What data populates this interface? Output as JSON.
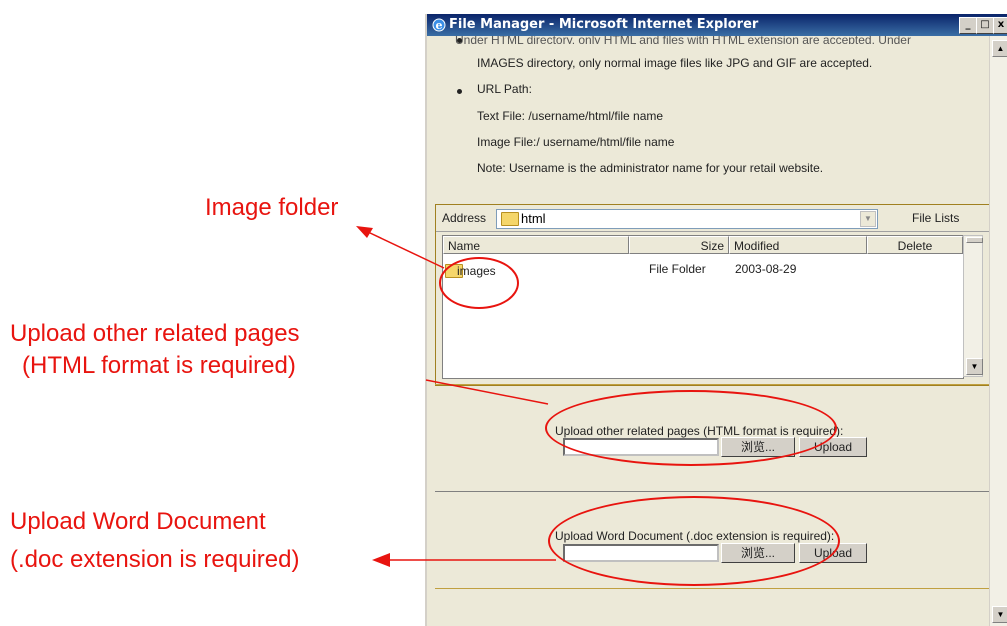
{
  "annotations": {
    "image_folder": "Image folder",
    "upload_pages_line1": "Upload other related pages",
    "upload_pages_line2": "(HTML format is required)",
    "upload_word_line1": "Upload Word Document",
    "upload_word_line2": "(.doc extension is required)"
  },
  "window": {
    "title": "File Manager - Microsoft Internet Explorer",
    "minimize": "_",
    "maximize": "□",
    "close": "x"
  },
  "info": {
    "cut_line": "Under HTML directory, only HTML and files with HTML extension are accepted. Under",
    "images_line": "IMAGES directory, only normal image files like JPG and GIF are accepted.",
    "url_path_label": "URL Path:",
    "text_file": "Text File: /username/html/file name",
    "image_file": "Image File:/ username/html/file name",
    "note": "Note: Username is the administrator name for your retail website."
  },
  "file_panel": {
    "address_label": "Address",
    "address_value": "html",
    "file_lists": "File Lists",
    "columns": {
      "name": "Name",
      "size": "Size",
      "modified": "Modified",
      "delete": "Delete"
    },
    "rows": [
      {
        "name": "images",
        "size": "File Folder",
        "modified": "2003-08-29",
        "delete": ""
      }
    ]
  },
  "upload_pages": {
    "label": "Upload other related pages (HTML format is required):",
    "browse": "浏览...",
    "upload": "Upload",
    "value": ""
  },
  "upload_word": {
    "label": "Upload Word Document (.doc extension is required):",
    "browse": "浏览...",
    "upload": "Upload",
    "value": ""
  },
  "colors": {
    "annotation": "#e8140f",
    "titlebar": "#0a246a",
    "window_bg": "#ece9d8"
  }
}
